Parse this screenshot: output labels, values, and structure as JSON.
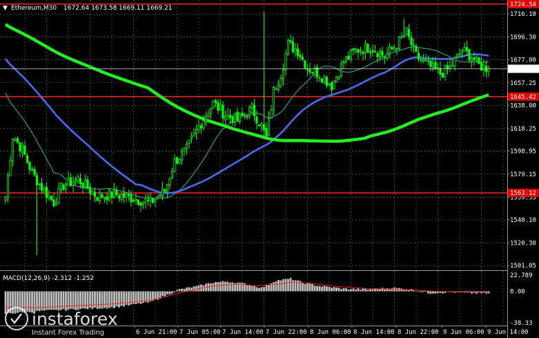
{
  "header": {
    "arrow": "▼",
    "symbol": "Ethereum,M30",
    "ohlc": "1672.64 1673.58 1669.11 1669.21"
  },
  "watermark": {
    "brand": "instaforex",
    "slogan": "Instant Forex Trading"
  },
  "colors": {
    "background": "#000000",
    "grid": "#9a9a9a",
    "candle": "#00ff00",
    "level_line": "#ff2020",
    "ma_fast": "#2a8a7a",
    "ma_mid": "#4a6cf0",
    "ma_slow": "#22ee22",
    "macd_hist": "#c0c0c0",
    "macd_signal": "#ff2020",
    "price_label": "#ffffff",
    "level_label": "#e00000"
  },
  "chart_data": [
    {
      "type": "candlestick",
      "ylim": [
        1497,
        1728
      ],
      "y_ticks": [
        "1716.10",
        "1696.30",
        "1677.00",
        "1657.25",
        "1638.00",
        "1618.25",
        "1598.95",
        "1579.15",
        "1559.35",
        "1540.10",
        "1520.30",
        "1501.05"
      ],
      "x_labels": [
        "6 Jun 21:00",
        "7 Jun 05:00",
        "7 Jun 14:00",
        "7 Jun 22:00",
        "8 Jun 06:00",
        "8 Jun 14:00",
        "8 Jun 22:00",
        "9 Jun 06:00",
        "9 Jun 14:00"
      ],
      "current_price": "1669.21",
      "levels": [
        {
          "value": 1724.54,
          "label": "1724.54"
        },
        {
          "value": 1645.42,
          "label": "1645.42"
        },
        {
          "value": 1563.12,
          "label": "1563.12"
        }
      ],
      "close_anchors": [
        [
          0,
          1560
        ],
        [
          3,
          1612
        ],
        [
          7,
          1600
        ],
        [
          11,
          1580
        ],
        [
          15,
          1568
        ],
        [
          20,
          1555
        ],
        [
          24,
          1570
        ],
        [
          30,
          1575
        ],
        [
          38,
          1560
        ],
        [
          45,
          1562
        ],
        [
          50,
          1560
        ],
        [
          60,
          1555
        ],
        [
          66,
          1565
        ],
        [
          70,
          1590
        ],
        [
          75,
          1600
        ],
        [
          80,
          1620
        ],
        [
          86,
          1640
        ],
        [
          91,
          1630
        ],
        [
          96,
          1625
        ],
        [
          102,
          1635
        ],
        [
          106,
          1620
        ],
        [
          108,
          1610
        ],
        [
          111,
          1650
        ],
        [
          114,
          1665
        ],
        [
          117,
          1690
        ],
        [
          121,
          1685
        ],
        [
          125,
          1670
        ],
        [
          130,
          1665
        ],
        [
          135,
          1655
        ],
        [
          140,
          1675
        ],
        [
          145,
          1685
        ],
        [
          151,
          1688
        ],
        [
          157,
          1680
        ],
        [
          162,
          1690
        ],
        [
          166,
          1700
        ],
        [
          170,
          1680
        ],
        [
          175,
          1672
        ],
        [
          180,
          1665
        ],
        [
          184,
          1670
        ],
        [
          189,
          1685
        ],
        [
          193,
          1680
        ],
        [
          196,
          1672
        ],
        [
          200,
          1669.21
        ]
      ],
      "wick_events": [
        {
          "index": 13,
          "low": 1510
        },
        {
          "index": 107,
          "high": 1718
        },
        {
          "index": 165,
          "high": 1712
        }
      ]
    },
    {
      "type": "histogram",
      "title": "MACD(12,26,9) -2.312 -1.252",
      "ylim": [
        -38.33,
        22.79
      ],
      "y_ticks": [
        "22.789",
        "0.00",
        "-38.33"
      ],
      "hist_anchors": [
        [
          0,
          -25
        ],
        [
          15,
          -22
        ],
        [
          30,
          -20
        ],
        [
          45,
          -18
        ],
        [
          60,
          -12
        ],
        [
          66,
          -5
        ],
        [
          72,
          2
        ],
        [
          80,
          6
        ],
        [
          86,
          10
        ],
        [
          92,
          11
        ],
        [
          100,
          8
        ],
        [
          106,
          4
        ],
        [
          112,
          12
        ],
        [
          118,
          14
        ],
        [
          124,
          9
        ],
        [
          130,
          6
        ],
        [
          140,
          3
        ],
        [
          150,
          2
        ],
        [
          160,
          4
        ],
        [
          168,
          2
        ],
        [
          175,
          -2
        ],
        [
          185,
          -1
        ],
        [
          192,
          -2
        ],
        [
          200,
          -2.312
        ]
      ],
      "signal_anchors": [
        [
          0,
          -18
        ],
        [
          15,
          -18
        ],
        [
          30,
          -16
        ],
        [
          45,
          -14
        ],
        [
          60,
          -10
        ],
        [
          72,
          -2
        ],
        [
          80,
          3
        ],
        [
          86,
          6
        ],
        [
          96,
          8
        ],
        [
          104,
          6
        ],
        [
          112,
          8
        ],
        [
          118,
          10
        ],
        [
          126,
          9
        ],
        [
          135,
          6
        ],
        [
          150,
          3
        ],
        [
          165,
          2
        ],
        [
          178,
          0
        ],
        [
          190,
          -1
        ],
        [
          200,
          -1.252
        ]
      ]
    }
  ]
}
